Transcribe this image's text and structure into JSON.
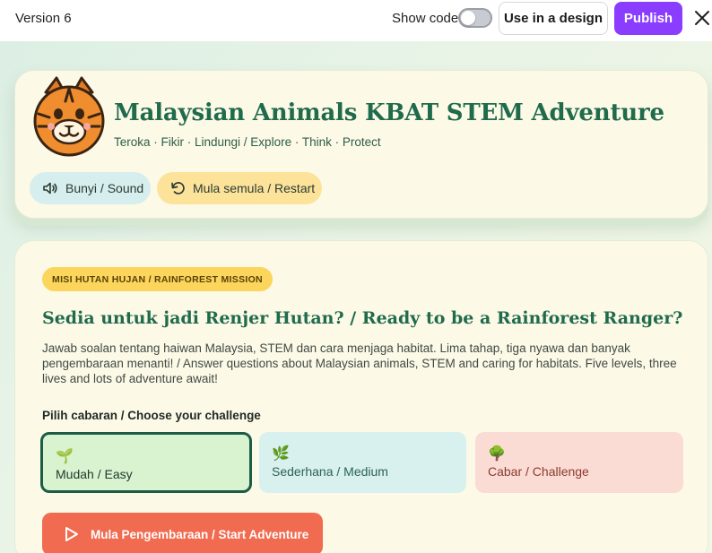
{
  "topbar": {
    "version": "Version 6",
    "show_code_label": "Show code",
    "show_code_enabled": false,
    "use_in_design_label": "Use in a design",
    "publish_label": "Publish",
    "accent_color": "#8b3dff"
  },
  "header": {
    "title": "Malaysian Animals KBAT STEM Adventure",
    "subtitle": "Teroka · Fikir · Lindungi / Explore · Think · Protect",
    "sound_label": "Bunyi / Sound",
    "restart_label": "Mula semula / Restart",
    "mascot_icon": "tiger-mascot"
  },
  "mission": {
    "badge": "MISI HUTAN HUJAN / RAINFOREST MISSION",
    "title": "Sedia untuk jadi Renjer Hutan? / Ready to be a Rainforest Ranger?",
    "description": "Jawab soalan tentang haiwan Malaysia, STEM dan cara menjaga habitat. Lima tahap, tiga nyawa dan banyak pengembaraan menanti! / Answer questions about Malaysian animals, STEM and caring for habitats. Five levels, three lives and lots of adventure await!",
    "choose_label": "Pilih cabaran / Choose your challenge",
    "levels": [
      {
        "icon": "🌱",
        "label": "Mudah / Easy",
        "selected": true
      },
      {
        "icon": "🌿",
        "label": "Sederhana / Medium",
        "selected": false
      },
      {
        "icon": "🌳",
        "label": "Cabar / Challenge",
        "selected": false
      }
    ],
    "start_label": "Mula Pengembaraan / Start Adventure"
  },
  "colors": {
    "title_green": "#1f6b4c",
    "badge_yellow": "#fbd55c",
    "start_orange": "#f06b50"
  }
}
